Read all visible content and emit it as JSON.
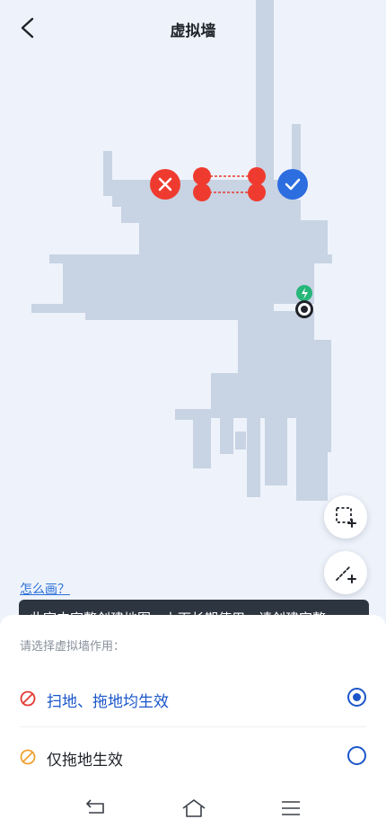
{
  "header": {
    "title": "虚拟墙",
    "back_icon": "back-chevron-icon"
  },
  "map": {
    "cancel_icon": "close-icon",
    "confirm_icon": "check-icon",
    "charger_icon": "charging-dock-icon",
    "robot_icon": "robot-icon",
    "colors": {
      "floor": "#c8d3e3",
      "wall_line": "#e83a2e",
      "cancel": "#ef3b2f",
      "confirm": "#2c6de0"
    }
  },
  "tools": {
    "area_button_icon": "add-area-icon",
    "wall_button_icon": "add-line-icon"
  },
  "help": {
    "link_text": "怎么画？"
  },
  "tooltip": {
    "text": "此室内家整创建地图，上下长期使用，请创建完整"
  },
  "sheet": {
    "prompt": "请选择虚拟墙作用：",
    "options": [
      {
        "label": "扫地、拖地均生效",
        "icon": "forbidden-icon",
        "color": "#1a56c9",
        "icon_color": "#e23b33",
        "selected": true
      },
      {
        "label": "仅拖地生效",
        "icon": "forbidden-icon",
        "color": "#1f2329",
        "icon_color": "#f0a233",
        "selected": false
      }
    ]
  },
  "navbar": {
    "back": "nav-back-icon",
    "home": "nav-home-icon",
    "menu": "nav-menu-icon"
  }
}
